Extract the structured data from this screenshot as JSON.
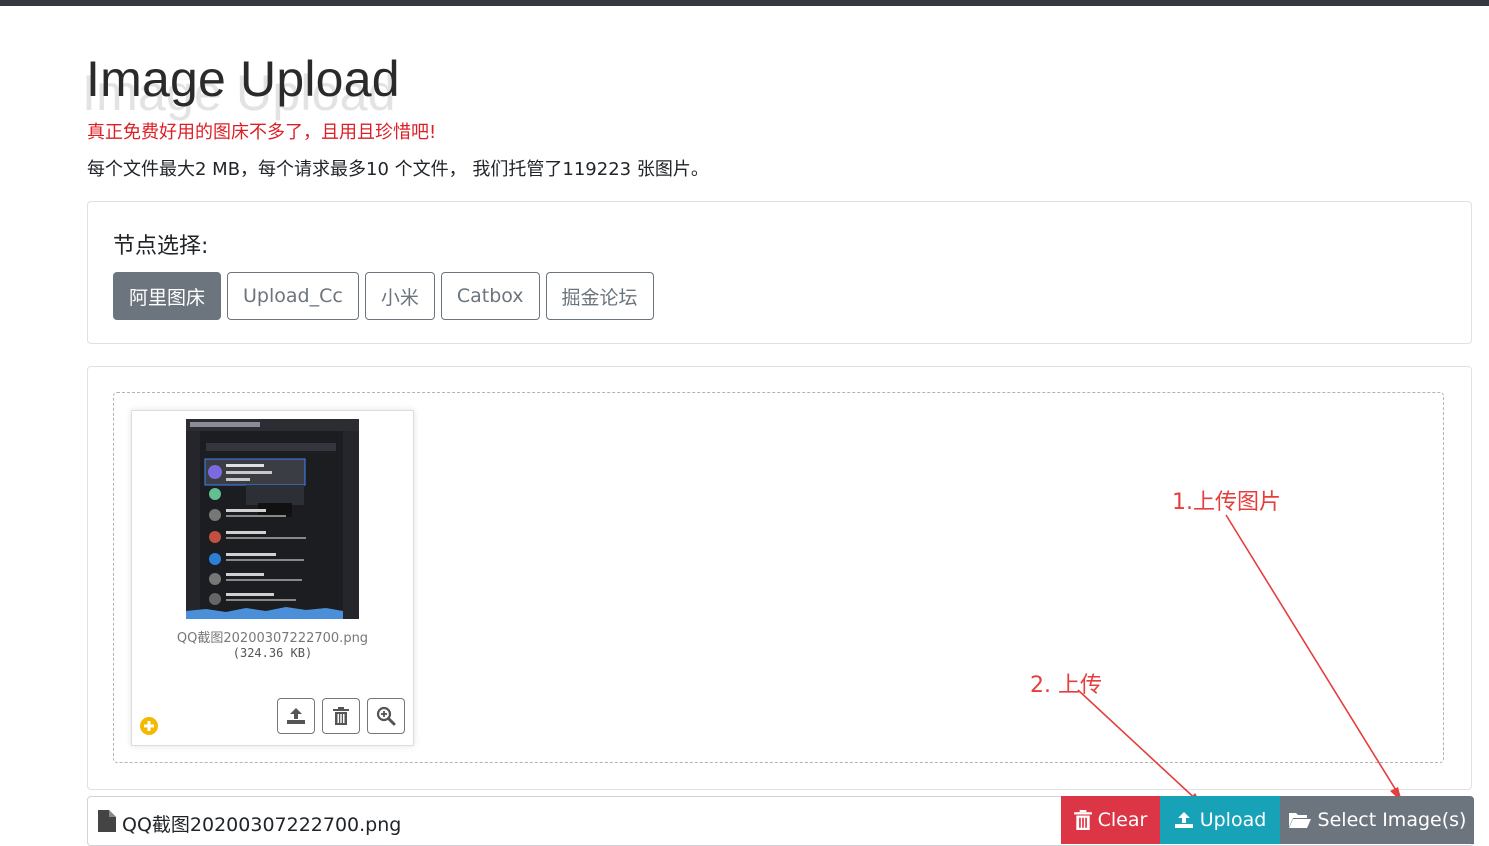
{
  "header": {
    "title": "Image Upload",
    "notice": "真正免费好用的图床不多了，且用且珍惜吧!",
    "info": "每个文件最大2 MB，每个请求最多10 个文件， 我们托管了119223 张图片。"
  },
  "nodes": {
    "label": "节点选择:",
    "options": [
      "阿里图床",
      "Upload_Cc",
      "小米",
      "Catbox",
      "掘金论坛"
    ],
    "selected": "阿里图床"
  },
  "preview": {
    "file_name": "QQ截图20200307222700.png",
    "file_size": "(324.36 KB)",
    "actions": [
      "upload-icon",
      "trash-icon",
      "zoom-in-icon"
    ]
  },
  "annotations": {
    "step1": "1.上传图片",
    "step2": "2. 上传"
  },
  "file_bar": {
    "file_name": "QQ截图20200307222700.png",
    "clear_label": "Clear",
    "upload_label": "Upload",
    "select_label": "Select Image(s)"
  },
  "colors": {
    "danger": "#dc3545",
    "info": "#17a2b8",
    "secondary": "#6c757d",
    "annotation": "#e63d3d",
    "notice": "#dc1f26"
  }
}
